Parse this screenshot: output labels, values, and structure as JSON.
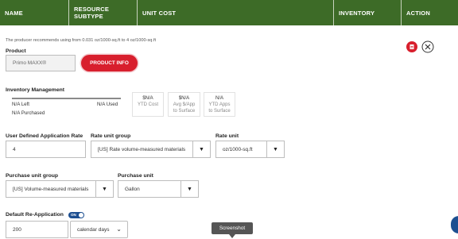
{
  "header": {
    "columns": [
      {
        "label": "NAME"
      },
      {
        "label": "RESOURCE",
        "label2": "SUBTYPE"
      },
      {
        "label": "UNIT COST"
      },
      {
        "label": "INVENTORY"
      },
      {
        "label": "ACTION"
      }
    ]
  },
  "recommendation": "The producer recommends using from 0.031 oz/1000-sq.ft to 4 oz/1000-sq.ft",
  "product": {
    "label": "Product",
    "value": "Primo MAXX®",
    "info_button": "PRODUCT INFO"
  },
  "actions": {
    "pdf_icon": "pdf-icon",
    "close_icon": "close-circle-icon"
  },
  "inventory": {
    "title": "Inventory Management",
    "left": "N/A Left",
    "used": "N/A Used",
    "purchased": "N/A Purchased",
    "stats": [
      {
        "value": "$N/A",
        "label": "YTD Cost",
        "label2": ""
      },
      {
        "value": "$N/A",
        "label": "Avg $/App",
        "label2": "to Surface"
      },
      {
        "value": "N/A",
        "label": "YTD Apps",
        "label2": "to Surface"
      }
    ]
  },
  "application_rate": {
    "label": "User Defined Application Rate",
    "value": "4"
  },
  "rate_unit_group": {
    "label": "Rate unit group",
    "selected": "[US] Rate volume-measured materials"
  },
  "rate_unit": {
    "label": "Rate unit",
    "selected": "oz/1000-sq.ft"
  },
  "purchase_unit_group": {
    "label": "Purchase unit group",
    "selected": "[US] Volume-measured materials"
  },
  "purchase_unit": {
    "label": "Purchase unit",
    "selected": "Gallon"
  },
  "reapplication": {
    "label": "Default Re-Application",
    "toggle_text": "ON",
    "value": "200",
    "unit_selected": "calendar days"
  },
  "tooltip": "Screenshot",
  "colors": {
    "header_bg": "#3d6b27",
    "accent_red": "#d81f2d",
    "toggle_blue": "#1d4f91"
  }
}
